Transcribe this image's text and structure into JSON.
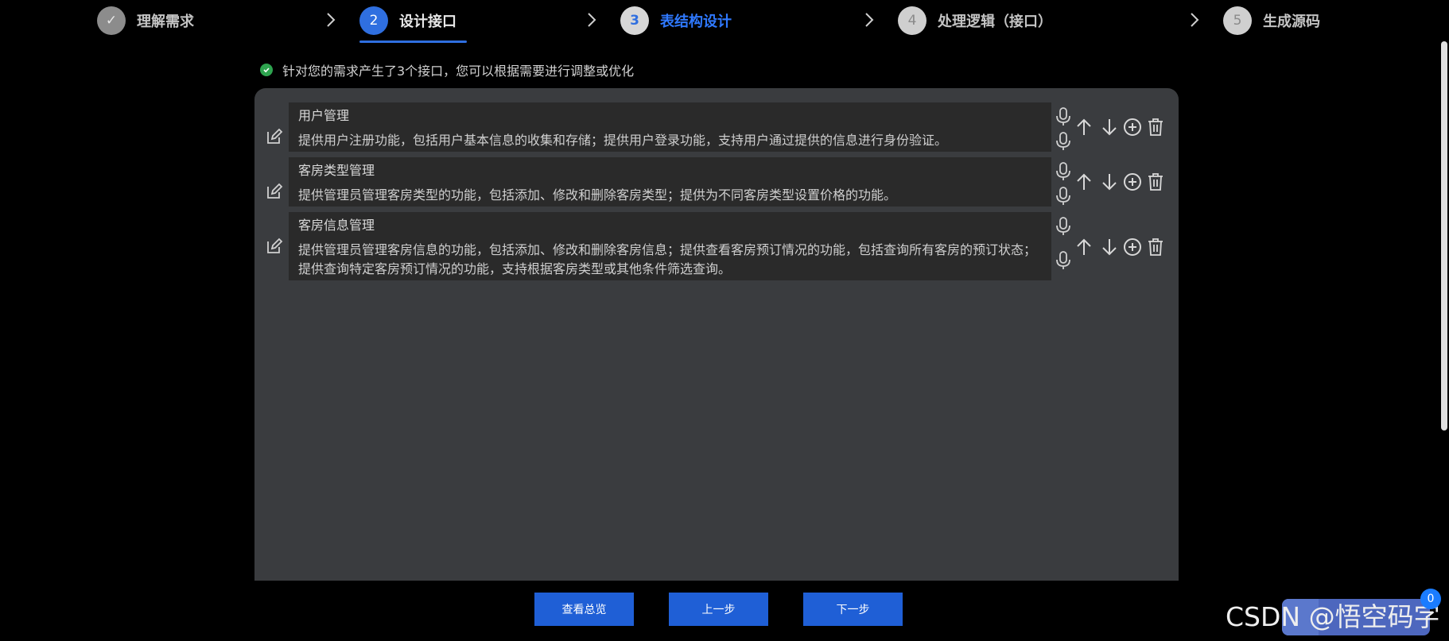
{
  "steps": [
    {
      "number": "✓",
      "label": "理解需求",
      "state": "done"
    },
    {
      "number": "2",
      "label": "设计接口",
      "state": "active"
    },
    {
      "number": "3",
      "label": "表结构设计",
      "state": "current"
    },
    {
      "number": "4",
      "label": "处理逻辑（接口）",
      "state": "todo"
    },
    {
      "number": "5",
      "label": "生成源码",
      "state": "todo"
    }
  ],
  "info": {
    "message": "针对您的需求产生了3个接口，您可以根据需要进行调整或优化"
  },
  "interfaces": [
    {
      "title": "用户管理",
      "description": "提供用户注册功能，包括用户基本信息的收集和存储；提供用户登录功能，支持用户通过提供的信息进行身份验证。"
    },
    {
      "title": "客房类型管理",
      "description": "提供管理员管理客房类型的功能，包括添加、修改和删除客房类型；提供为不同客房类型设置价格的功能。"
    },
    {
      "title": "客房信息管理",
      "description": "提供管理员管理客房信息的功能，包括添加、修改和删除客房信息；提供查看客房预订情况的功能，包括查询所有客房的预订状态；提供查询特定客房预订情况的功能，支持根据客房类型或其他条件筛选查询。"
    }
  ],
  "footer": {
    "overview_label": "查看总览",
    "prev_label": "上一步",
    "next_label": "下一步"
  },
  "watermark": "CSDN @悟空码字",
  "badge": "0",
  "colors": {
    "accent": "#2f6fe0",
    "success": "#2ea44f",
    "panel": "#3a3c3f",
    "card": "#2a2a2a"
  }
}
